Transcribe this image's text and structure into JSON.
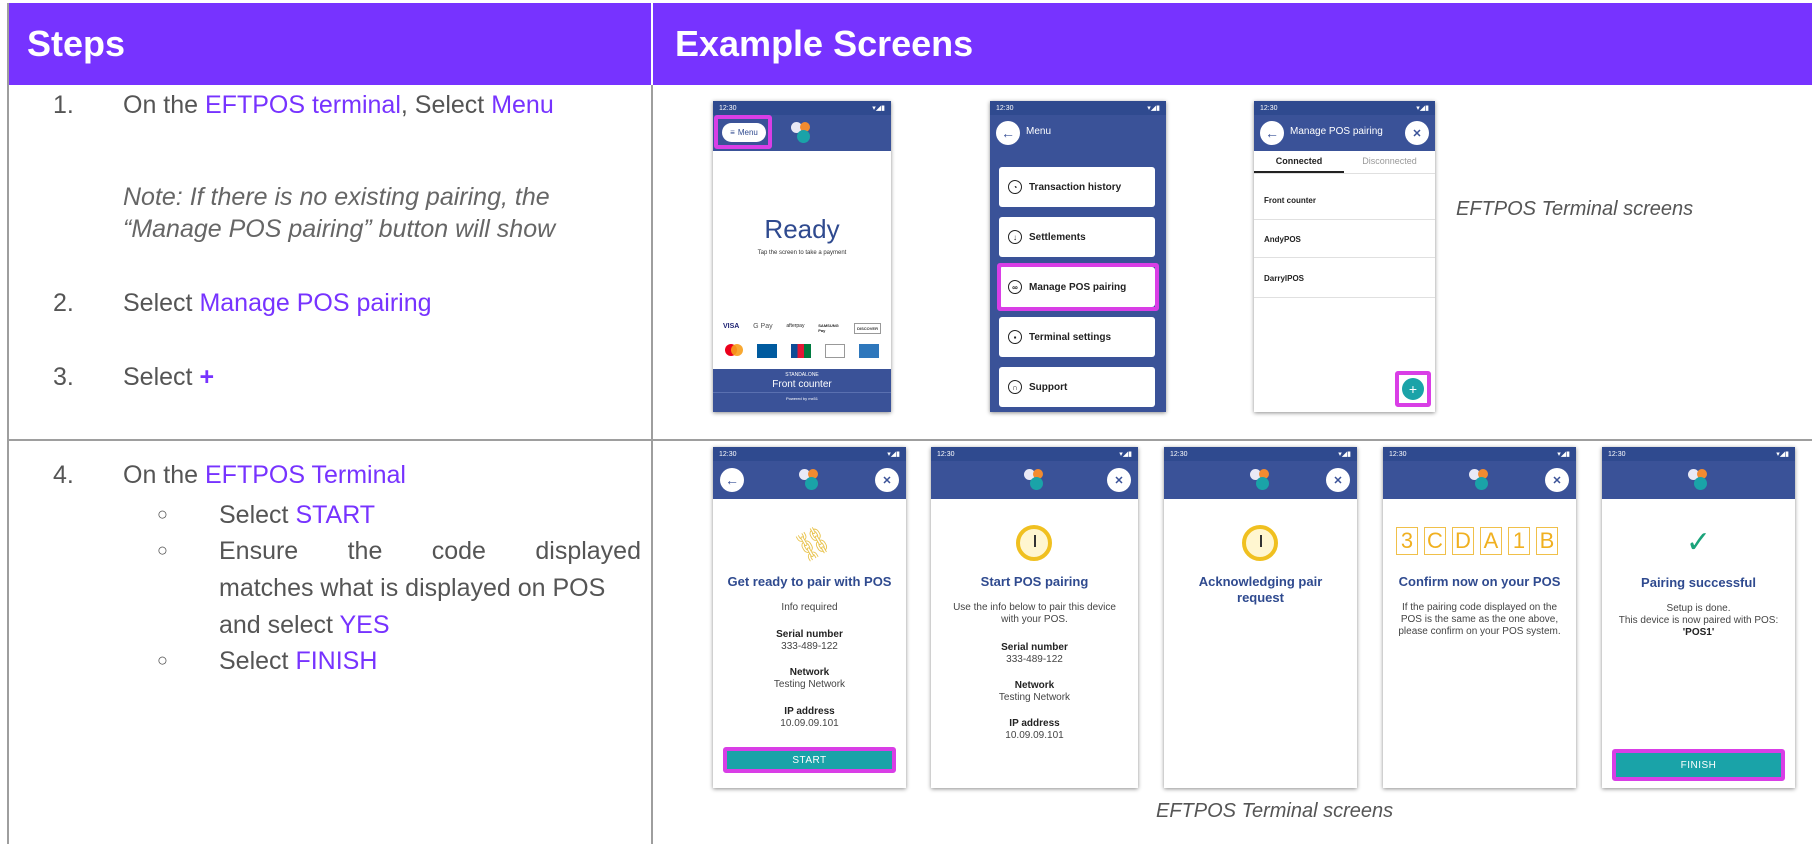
{
  "headers": {
    "steps": "Steps",
    "examples": "Example Screens"
  },
  "step1": {
    "num": "1.",
    "pre": "On the ",
    "hl1": "EFTPOS terminal",
    "mid": ", Select ",
    "hl2": "Menu"
  },
  "note": {
    "line1": "Note: If there is no existing pairing, the",
    "line2": "“Manage POS pairing” button will show"
  },
  "step2": {
    "num": "2.",
    "pre": "Select ",
    "hl": "Manage POS pairing"
  },
  "step3": {
    "num": "3.",
    "pre": "Select ",
    "plus": "+"
  },
  "step4": {
    "num": "4.",
    "pre": "On the ",
    "hl": "EFTPOS Terminal",
    "bullet": "○",
    "sub1_pre": "Select ",
    "sub1_hl": "START",
    "sub2_a": "Ensure the code displayed",
    "sub2_b": "matches what is displayed on POS",
    "sub2_c_pre": "and select ",
    "sub2_c_hl": "YES",
    "sub3_pre": "Select ",
    "sub3_hl": "FINISH"
  },
  "captions": {
    "row1": "EFTPOS Terminal screens",
    "row2": "EFTPOS Terminal screens"
  },
  "status": {
    "time": "12:30",
    "icons": "▾◢▮"
  },
  "screen_ready": {
    "menu_btn": "Menu",
    "ready": "Ready",
    "subtitle": "Tap the screen to take a payment",
    "cards1": [
      "VISA",
      "G Pay",
      "afterpay",
      "SAMSUNG Pay",
      "DISCOVER"
    ],
    "standalone": "STANDALONE",
    "front": "Front counter",
    "powered": "Powered by mx51"
  },
  "screen_menu": {
    "title": "Menu",
    "items": [
      "Transaction history",
      "Settlements",
      "Manage POS pairing",
      "Terminal settings",
      "Support"
    ]
  },
  "screen_manage": {
    "title": "Manage POS pairing",
    "tabs": [
      "Connected",
      "Disconnected"
    ],
    "list": [
      "Front counter",
      "AndyPOS",
      "DarrylPOS"
    ],
    "add": "+"
  },
  "screen_ready_pair": {
    "title": "Get ready to pair with POS",
    "info": "Info required",
    "serial_label": "Serial number",
    "serial": "333-489-122",
    "network_label": "Network",
    "network": "Testing Network",
    "ip_label": "IP address",
    "ip": "10.09.09.101",
    "button": "START"
  },
  "screen_start": {
    "title": "Start POS pairing",
    "info1": "Use the info below to pair this device",
    "info2": "with your POS.",
    "serial_label": "Serial number",
    "serial": "333-489-122",
    "network_label": "Network",
    "network": "Testing Network",
    "ip_label": "IP address",
    "ip": "10.09.09.101"
  },
  "screen_ack": {
    "title1": "Acknowledging pair",
    "title2": "request"
  },
  "screen_confirm": {
    "code": [
      "3",
      "C",
      "D",
      "A",
      "1",
      "B"
    ],
    "title": "Confirm now on your POS",
    "l1": "If the pairing code displayed on the",
    "l2": "POS is the same as the one above,",
    "l3": "please confirm on your POS system."
  },
  "screen_success": {
    "check": "✓",
    "title": "Pairing successful",
    "l1": "Setup is done.",
    "l2": "This device is now paired with POS:",
    "l3": "'POS1'",
    "button": "FINISH"
  },
  "icons": {
    "back": "←",
    "close": "✕",
    "hamburger": "≡",
    "clock": "◔"
  },
  "colors": {
    "header": "#7733ff",
    "highlight": "#7733ff",
    "terminal_blue": "#3a5298",
    "pink_highlight": "#d93ee6",
    "teal_button": "#1aa3a8"
  }
}
